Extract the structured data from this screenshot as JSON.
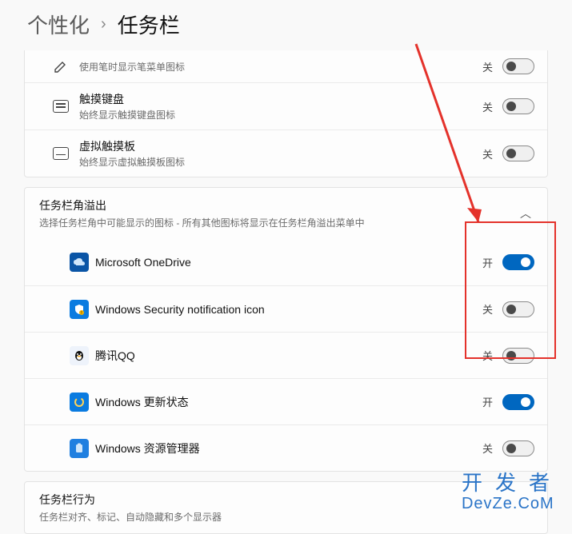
{
  "breadcrumb": {
    "parent": "个性化",
    "sep": "›",
    "current": "任务栏"
  },
  "toggle_labels": {
    "on": "开",
    "off": "关"
  },
  "top_rows": [
    {
      "title": "",
      "desc": "使用笔时显示笔菜单图标",
      "state": "off",
      "icon": "pen"
    },
    {
      "title": "触摸键盘",
      "desc": "始终显示触摸键盘图标",
      "state": "off",
      "icon": "keyboard"
    },
    {
      "title": "虚拟触摸板",
      "desc": "始终显示虚拟触摸板图标",
      "state": "off",
      "icon": "touchpad"
    }
  ],
  "overflow_header": {
    "title": "任务栏角溢出",
    "desc": "选择任务栏角中可能显示的图标 - 所有其他图标将显示在任务栏角溢出菜单中"
  },
  "overflow_items": [
    {
      "label": "Microsoft OneDrive",
      "state": "on",
      "icon": "onedrive"
    },
    {
      "label": "Windows Security notification icon",
      "state": "off",
      "icon": "security"
    },
    {
      "label": "腾讯QQ",
      "state": "off",
      "icon": "qq"
    },
    {
      "label": "Windows 更新状态",
      "state": "on",
      "icon": "update"
    },
    {
      "label": "Windows 资源管理器",
      "state": "off",
      "icon": "explorer"
    }
  ],
  "behavior_section": {
    "title": "任务栏行为",
    "desc": "任务栏对齐、标记、自动隐藏和多个显示器"
  },
  "watermark": {
    "cn": "开发者",
    "en": "DevZe.CoM"
  }
}
